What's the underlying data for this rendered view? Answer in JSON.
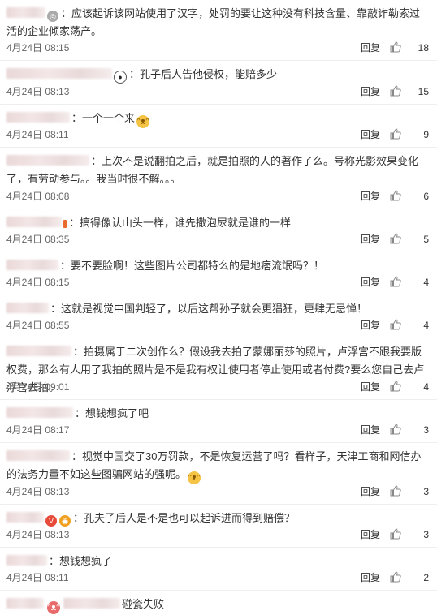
{
  "comments": [
    {
      "text": "应该起诉该网站使用了汉字，处罚的要让这种没有科技含量、靠敲诈勒索过活的企业倾家荡产。",
      "time": "4月24日 08:15",
      "reply": "回复",
      "likes": "18"
    },
    {
      "text": "孔子后人告他侵权，能赔多少",
      "time": "4月24日 08:13",
      "reply": "回复",
      "likes": "15"
    },
    {
      "text": "一个一个来",
      "time": "4月24日 08:11",
      "reply": "回复",
      "likes": "9"
    },
    {
      "text": "上次不是说翻拍之后，就是拍照的人的著作了么。号称光影效果变化了，有劳动参与。。我当时很不解。。。",
      "time": "4月24日 08:08",
      "reply": "回复",
      "likes": "6"
    },
    {
      "text": "搞得像认山头一样，谁先撒泡尿就是谁的一样",
      "time": "4月24日 08:35",
      "reply": "回复",
      "likes": "5"
    },
    {
      "text": "要不要脸啊！这些图片公司都特么的是地痞流氓吗？！",
      "time": "4月24日 08:15",
      "reply": "回复",
      "likes": "4"
    },
    {
      "text": "这就是视觉中国判轻了，以后这帮孙子就会更猖狂，更肆无忌惮！",
      "time": "4月24日 08:55",
      "reply": "回复",
      "likes": "4"
    },
    {
      "text": "拍摄属于二次创作么？假设我去拍了蒙娜丽莎的照片，卢浮宫不跟我要版权费，那么有人用了我拍的照片是不是我有权让使用者停止使用或者付费?要么您自己去卢浮宫去拍。",
      "time": "4月24日 09:01",
      "reply": "回复",
      "likes": "4"
    },
    {
      "text": "想钱想疯了吧",
      "time": "4月24日 08:17",
      "reply": "回复",
      "likes": "3"
    },
    {
      "text": "视觉中国交了30万罚款，不是恢复运营了吗？看样子，天津工商和网信办的法务力量不如这些图骗网站的强呢。",
      "time": "4月24日 08:13",
      "reply": "回复",
      "likes": "3"
    },
    {
      "text": "孔夫子后人是不是也可以起诉进而得到赔偿？",
      "time": "4月24日 08:13",
      "reply": "回复",
      "likes": "3"
    },
    {
      "text": "想钱想疯了",
      "time": "4月24日 08:11",
      "reply": "回复",
      "likes": "2"
    },
    {
      "text": "碰瓷失败",
      "time": "",
      "reply": "",
      "likes": ""
    }
  ],
  "icons": {
    "like": "thumbs-up-icon",
    "emoji": "doge-emoji-icon",
    "panda": "panda-icon",
    "vip": "vip-badge-icon",
    "medal": "medal-icon"
  },
  "colors": {
    "accent": "#f6c445",
    "meta": "#666666",
    "divider": "#eeeeee"
  }
}
